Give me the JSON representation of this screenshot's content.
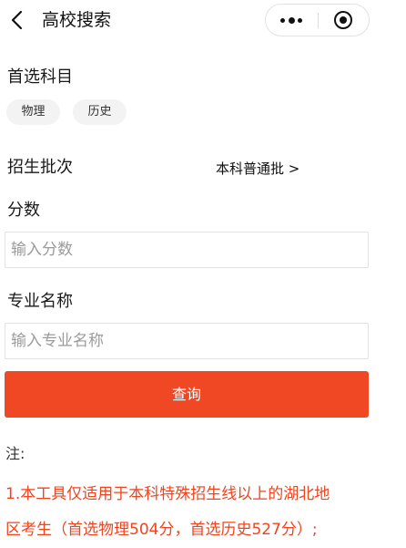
{
  "header": {
    "title": "高校搜索",
    "back_icon": "chevron-left-icon",
    "more_icon": "more-dots-icon",
    "close_icon": "target-close-icon"
  },
  "subject": {
    "label": "首选科目",
    "options": [
      "物理",
      "历史"
    ]
  },
  "batch": {
    "label": "招生批次",
    "value": "本科普通批 >"
  },
  "score": {
    "label": "分数",
    "placeholder": "输入分数",
    "value": ""
  },
  "major": {
    "label": "专业名称",
    "placeholder": "输入专业名称",
    "value": ""
  },
  "query_button": "查询",
  "notes": {
    "title": "注:",
    "lines": [
      "1.本工具仅适用于本科特殊招生线以上的湖北地",
      "区考生（首选物理504分，首选历史527分）;"
    ]
  },
  "colors": {
    "accent": "#f04724",
    "note_text": "#f0441f",
    "chip_bg": "#f3f3f3"
  }
}
